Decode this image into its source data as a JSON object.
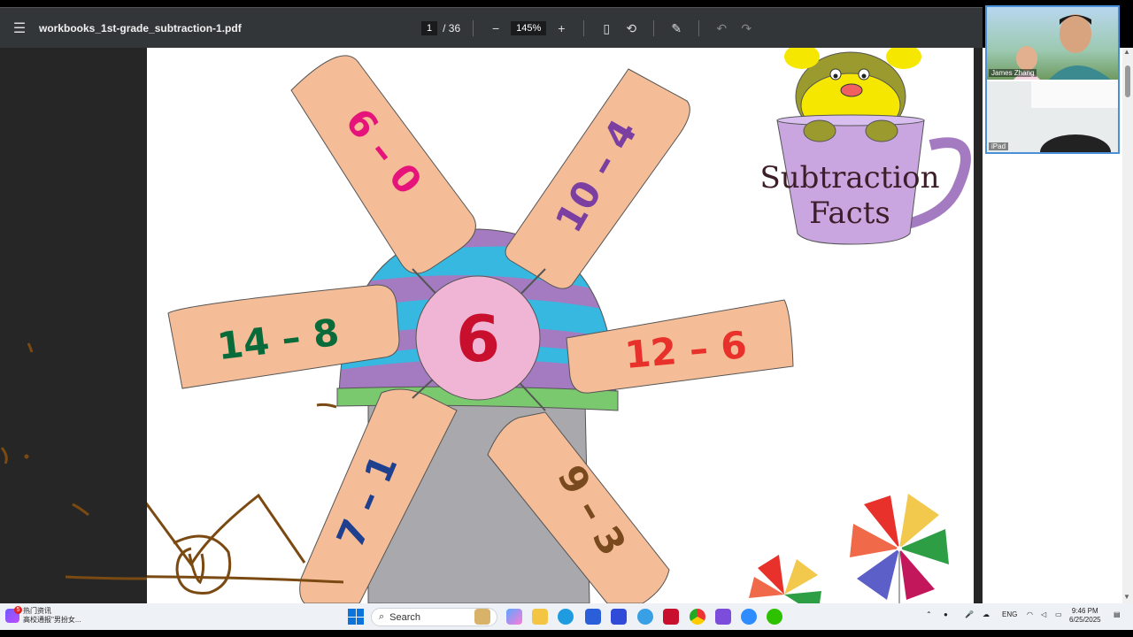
{
  "toolbar": {
    "filename": "workbooks_1st-grade_subtraction-1.pdf",
    "current_page": "1",
    "page_count": "/ 36",
    "zoom": "145%"
  },
  "worksheet": {
    "center_number": "6",
    "blades": [
      "6 – 0",
      "10 – 4",
      "14 – 8",
      "12 – 6",
      "7 – 1",
      "9 – 3"
    ],
    "cup_title_line1": "Subtraction",
    "cup_title_line2": "Facts"
  },
  "video": {
    "participant1": "James Zhang",
    "participant2": "iPad"
  },
  "taskbar": {
    "news_badge": "5",
    "news_title": "热门资讯",
    "news_subtitle": "高校通报\"男扮女...",
    "search_placeholder": "Search",
    "lang": "ENG",
    "time": "9:46 PM",
    "date": "6/25/2025"
  },
  "colors": {
    "blade": "#f4bd97",
    "hub": "#f0b4d4",
    "center_number": "#c8102e",
    "cup": "#c9a6e0",
    "blade_text": [
      "#e6137b",
      "#7a3fa0",
      "#0a6b3a",
      "#e8312a",
      "#1f3f8f",
      "#7a4a1f"
    ]
  }
}
